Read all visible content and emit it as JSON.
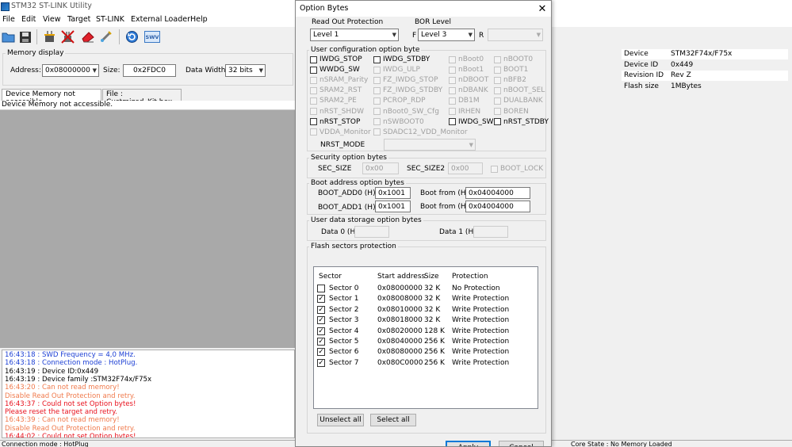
{
  "app": {
    "title": "STM32 ST-LINK Utility",
    "menu": [
      "File",
      "Edit",
      "View",
      "Target",
      "ST-LINK",
      "External Loader",
      "Help"
    ],
    "toolbar_icons": [
      "open-folder-icon",
      "save-icon",
      "connect-plug-icon",
      "disconnect-plug-icon",
      "erase-icon",
      "program-icon",
      "refresh-icon",
      "swv-icon"
    ],
    "swv_label": "SWV"
  },
  "memory_display": {
    "label": "Memory display",
    "address_label": "Address:",
    "address_value": "0x08000000",
    "size_label": "Size:",
    "size_value": "0x2FDC0",
    "data_width_label": "Data Width:",
    "data_width_value": "32 bits"
  },
  "device_info": [
    {
      "key": "Device",
      "value": "STM32F74x/F75x"
    },
    {
      "key": "Device ID",
      "value": "0x449"
    },
    {
      "key": "Revision ID",
      "value": "Rev Z"
    },
    {
      "key": "Flash size",
      "value": "1MBytes"
    }
  ],
  "tabs": [
    {
      "label": "Device Memory not accessible."
    },
    {
      "label": "File : Custmized_Kit.hex"
    }
  ],
  "memory_status": "Device Memory not accessible.",
  "log": [
    {
      "text": "16:43:18 : SWD Frequency = 4,0 MHz.",
      "color": "#1c3fd4"
    },
    {
      "text": "16:43:18 : Connection mode : HotPlug.",
      "color": "#1c3fd4"
    },
    {
      "text": "16:43:19 : Device ID:0x449",
      "color": "#000000"
    },
    {
      "text": "16:43:19 : Device family :STM32F74x/F75x",
      "color": "#000000"
    },
    {
      "text": "16:43:20 : Can not read memory!",
      "color": "#f07a4c"
    },
    {
      "text": "            Disable Read Out Protection and retry.",
      "color": "#f07a4c"
    },
    {
      "text": "16:43:37 : Could not set Option bytes!",
      "color": "#e8101c"
    },
    {
      "text": "            Please reset the target and retry.",
      "color": "#e8101c"
    },
    {
      "text": "16:43:39 : Can not read memory!",
      "color": "#f07a4c"
    },
    {
      "text": "            Disable Read Out Protection and retry.",
      "color": "#f07a4c"
    },
    {
      "text": "16:44:02 : Could not set Option bytes!",
      "color": "#e8101c"
    }
  ],
  "status": {
    "left": "Connection mode : HotPlug",
    "right": "Core State : No Memory Loaded"
  },
  "dialog": {
    "title": "Option Bytes",
    "read_out_protection_label": "Read Out Protection",
    "rdp_value": "Level 1",
    "bor_label": "BOR Level",
    "bor_f": "F",
    "bor_value": "Level 3",
    "bor_r": "R",
    "user_config_label": "User configuration option byte",
    "options": [
      {
        "label": "IWDG_STOP",
        "enabled": true
      },
      {
        "label": "IWDG_STDBY",
        "enabled": true
      },
      {
        "label": "nBoot0",
        "enabled": false
      },
      {
        "label": "nBOOT0",
        "enabled": false
      },
      {
        "label": "WWDG_SW",
        "enabled": true
      },
      {
        "label": "IWDG_ULP",
        "enabled": false
      },
      {
        "label": "nBoot1",
        "enabled": false
      },
      {
        "label": "BOOT1",
        "enabled": false
      },
      {
        "label": "nSRAM_Parity",
        "enabled": false
      },
      {
        "label": "FZ_IWDG_STOP",
        "enabled": false
      },
      {
        "label": "nDBOOT",
        "enabled": false
      },
      {
        "label": "nBFB2",
        "enabled": false
      },
      {
        "label": "SRAM2_RST",
        "enabled": false
      },
      {
        "label": "FZ_IWDG_STDBY",
        "enabled": false
      },
      {
        "label": "nDBANK",
        "enabled": false
      },
      {
        "label": "nBOOT_SEL",
        "enabled": false
      },
      {
        "label": "SRAM2_PE",
        "enabled": false
      },
      {
        "label": "PCROP_RDP",
        "enabled": false
      },
      {
        "label": "DB1M",
        "enabled": false
      },
      {
        "label": "DUALBANK",
        "enabled": false
      },
      {
        "label": "nRST_SHDW",
        "enabled": false
      },
      {
        "label": "nBoot0_SW_Cfg",
        "enabled": false
      },
      {
        "label": "IRHEN",
        "enabled": false
      },
      {
        "label": "BOREN",
        "enabled": false
      },
      {
        "label": "nRST_STOP",
        "enabled": true
      },
      {
        "label": "nSWBOOT0",
        "enabled": false
      },
      {
        "label": "IWDG_SW",
        "enabled": true
      },
      {
        "label": "nRST_STDBY",
        "enabled": true
      },
      {
        "label": "VDDA_Monitor",
        "enabled": false
      },
      {
        "label": "SDADC12_VDD_Monitor",
        "enabled": false
      }
    ],
    "nrst_mode_label": "NRST_MODE",
    "security_label": "Security option bytes",
    "sec_size_label": "SEC_SIZE",
    "sec_size_value": "0x00",
    "sec_size2_label": "SEC_SIZE2",
    "sec_size2_value": "0x00",
    "boot_lock_label": "BOOT_LOCK",
    "boot_address_label": "Boot address option bytes",
    "boot_add0_label": "BOOT_ADD0 (H)",
    "boot_add0_value": "0x1001",
    "boot_from0_label": "Boot from (H)",
    "boot_from0_value": "0x04004000",
    "boot_add1_label": "BOOT_ADD1 (H)",
    "boot_add1_value": "0x1001",
    "boot_from1_label": "Boot from (H)",
    "boot_from1_value": "0x04004000",
    "user_data_label": "User data storage option bytes",
    "data0_label": "Data 0 (H)",
    "data1_label": "Data 1 (H)",
    "flash_label": "Flash sectors protection",
    "sector_headers": [
      "Sector",
      "Start address",
      "Size",
      "Protection"
    ],
    "sectors": [
      {
        "name": "Sector 0",
        "address": "0x08000000",
        "size": "32 K",
        "protection": "No Protection",
        "checked": false
      },
      {
        "name": "Sector 1",
        "address": "0x08008000",
        "size": "32 K",
        "protection": "Write Protection",
        "checked": true
      },
      {
        "name": "Sector 2",
        "address": "0x08010000",
        "size": "32 K",
        "protection": "Write Protection",
        "checked": true
      },
      {
        "name": "Sector 3",
        "address": "0x08018000",
        "size": "32 K",
        "protection": "Write Protection",
        "checked": true
      },
      {
        "name": "Sector 4",
        "address": "0x08020000",
        "size": "128 K",
        "protection": "Write Protection",
        "checked": true
      },
      {
        "name": "Sector 5",
        "address": "0x08040000",
        "size": "256 K",
        "protection": "Write Protection",
        "checked": true
      },
      {
        "name": "Sector 6",
        "address": "0x08080000",
        "size": "256 K",
        "protection": "Write Protection",
        "checked": true
      },
      {
        "name": "Sector 7",
        "address": "0x080C0000",
        "size": "256 K",
        "protection": "Write Protection",
        "checked": true
      }
    ],
    "unselect_all": "Unselect all",
    "select_all": "Select all",
    "apply": "Apply",
    "cancel": "Cancel"
  }
}
